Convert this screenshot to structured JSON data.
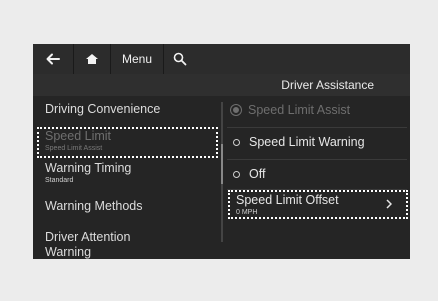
{
  "topbar": {
    "back_icon": "back-arrow-icon",
    "home_icon": "home-icon",
    "menu_label": "Menu",
    "search_icon": "search-icon"
  },
  "header": {
    "title": "Driver Assistance"
  },
  "left_menu": {
    "items": [
      {
        "label": "Driving Convenience",
        "sub": ""
      },
      {
        "label": "Speed Limit",
        "sub": "Speed Limit Assist"
      },
      {
        "label": "Warning Timing",
        "sub": "Standard"
      },
      {
        "label": "Warning Methods",
        "sub": ""
      },
      {
        "label": "Driver Attention Warning",
        "sub": ""
      }
    ]
  },
  "right_panel": {
    "options": [
      {
        "label": "Speed Limit Assist",
        "state": "selected-disabled"
      },
      {
        "label": "Speed Limit Warning",
        "state": "unselected"
      },
      {
        "label": "Off",
        "state": "unselected"
      }
    ],
    "offset": {
      "label": "Speed Limit Offset",
      "value": "0 MPH",
      "chevron_icon": "chevron-right-icon"
    }
  },
  "colors": {
    "screen_bg": "#252525",
    "text": "#e6e6e6",
    "dim_text": "#6e6e6e",
    "focus_border": "#ffffff"
  }
}
